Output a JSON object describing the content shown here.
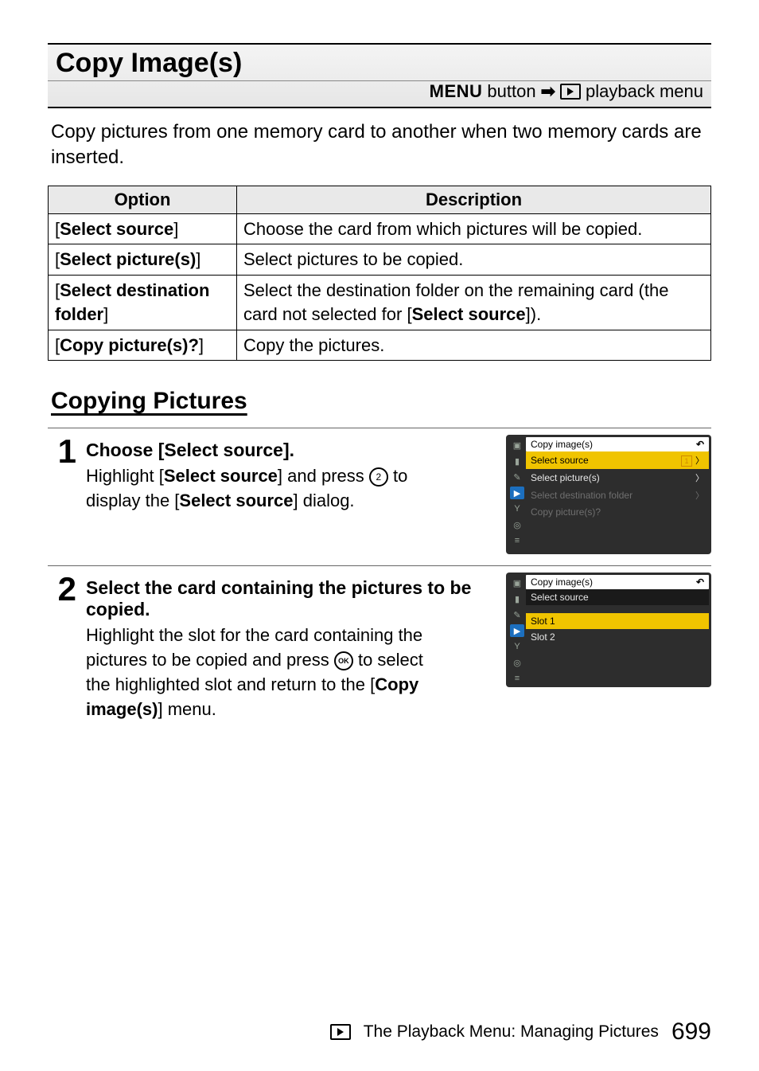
{
  "title": "Copy Image(s)",
  "breadcrumb": {
    "menu_word": "MENU",
    "button_word": "button",
    "trail": "playback menu"
  },
  "intro": "Copy pictures from one memory card to another when two memory cards are inserted.",
  "table": {
    "head_option": "Option",
    "head_desc": "Description",
    "rows": [
      {
        "option": "Select source",
        "desc_pre": "Choose the card from which pictures will be copied."
      },
      {
        "option": "Select picture(s)",
        "desc_pre": "Select pictures to be copied."
      },
      {
        "option": "Select destination folder",
        "desc_pre": "Select the destination folder on the remaining card (the card not selected for [",
        "desc_bold": "Select source",
        "desc_post": "])."
      },
      {
        "option": "Copy picture(s)?",
        "desc_pre": "Copy the pictures."
      }
    ]
  },
  "section_heading": "Copying Pictures",
  "step1": {
    "num": "1",
    "title": "Choose [Select source].",
    "text_pre": "Highlight [",
    "text_bold1": "Select source",
    "text_mid": "] and press ",
    "text_post1": " to display the [",
    "text_bold2": "Select source",
    "text_post2": "] dialog.",
    "right_icon_label": "2",
    "menu": {
      "header": "Copy image(s)",
      "items": [
        {
          "label": "Select source",
          "sel": true,
          "card": true,
          "chev": true
        },
        {
          "label": "Select picture(s)",
          "chev": true
        },
        {
          "label": "Select destination folder",
          "dim": true,
          "chev": true
        },
        {
          "label": "Copy picture(s)?",
          "dim": true
        }
      ]
    }
  },
  "step2": {
    "num": "2",
    "title": "Select the card containing the pictures to be copied.",
    "text_pre": "Highlight the slot for the card containing the pictures to be copied and press ",
    "ok_label": "OK",
    "text_mid": " to select the highlighted slot and return to the [",
    "text_bold": "Copy image(s)",
    "text_post": "] menu.",
    "menu": {
      "header": "Copy image(s)",
      "sub": "Select source",
      "items": [
        {
          "label": "Slot 1",
          "sel": true
        },
        {
          "label": "Slot 2"
        }
      ]
    }
  },
  "footer": {
    "section": "The Playback Menu: Managing Pictures",
    "page": "699"
  }
}
